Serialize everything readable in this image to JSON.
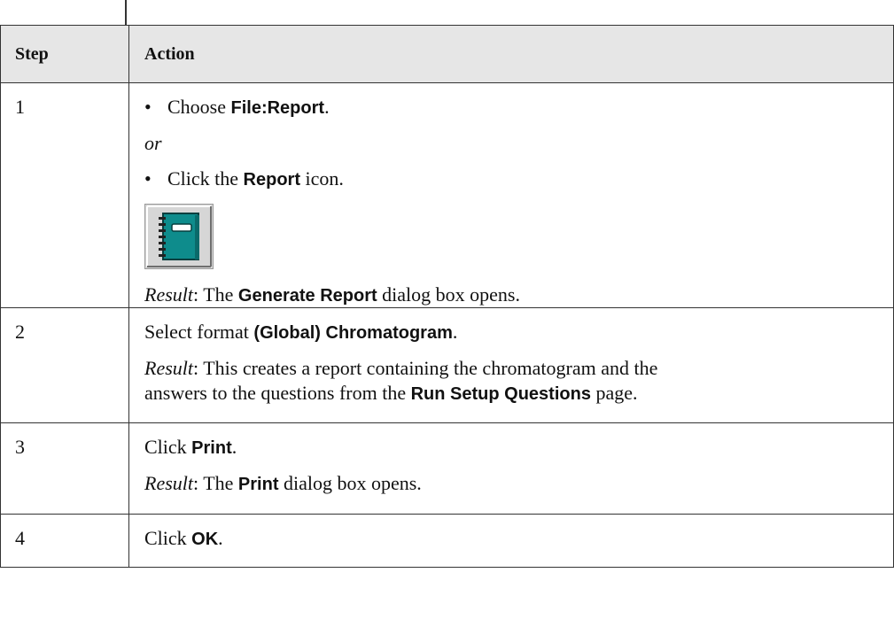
{
  "table": {
    "headers": {
      "step": "Step",
      "action": "Action"
    },
    "rows": [
      {
        "step": "1",
        "lines": [
          {
            "pre": "Choose ",
            "bold": "File:Report",
            "post": "."
          },
          {
            "italic": "or"
          },
          {
            "pre": "Click the ",
            "bold": "Report",
            "post": " icon."
          },
          {
            "result_label": "Result",
            "pre": ": The ",
            "bold": "Generate Report",
            "post": " dialog box opens."
          }
        ],
        "icon": "report-notebook-icon"
      },
      {
        "step": "2",
        "lines": [
          {
            "pre": "Select format ",
            "bold": "(Global) Chromatogram",
            "post": "."
          },
          {
            "result_label": "Result",
            "pre": ": This creates a report containing the chromatogram and the"
          },
          {
            "pre": "answers to the questions from the ",
            "bold": "Run Setup Questions",
            "post": " page."
          }
        ]
      },
      {
        "step": "3",
        "lines": [
          {
            "pre": "Click ",
            "bold": "Print",
            "post": "."
          },
          {
            "result_label": "Result",
            "pre": ": The ",
            "bold": "Print",
            "post": " dialog box opens."
          }
        ]
      },
      {
        "step": "4",
        "lines": [
          {
            "pre": "Click ",
            "bold": "OK",
            "post": "."
          }
        ]
      }
    ]
  },
  "colors": {
    "icon_teal": "#0e8c8c",
    "header_bg": "#e6e6e6",
    "rule": "#333333"
  }
}
